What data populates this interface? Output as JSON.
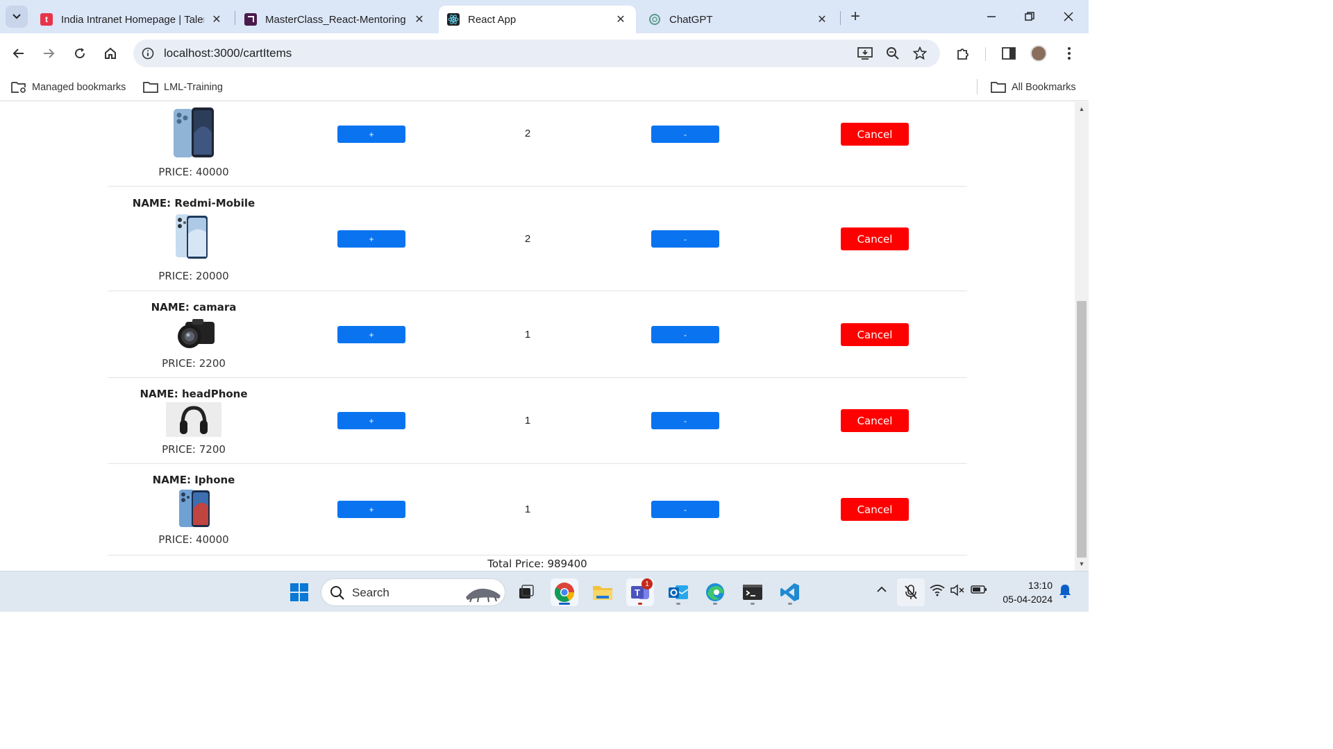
{
  "browser": {
    "tabs": [
      {
        "title": "India Intranet Homepage | Taler",
        "favicon_color": "#e8344a",
        "favicon_letter": "t",
        "active": false
      },
      {
        "title": "MasterClass_React-Mentoring s",
        "favicon_color": "#4a1a4a",
        "favicon_letter": "",
        "active": false
      },
      {
        "title": "React App",
        "favicon_color": "#222222",
        "favicon_letter": "",
        "active": true
      },
      {
        "title": "ChatGPT",
        "favicon_color": "#ffffff",
        "favicon_letter": "",
        "active": false
      }
    ],
    "url": "localhost:3000/cartItems",
    "bookmarks": {
      "managed": "Managed bookmarks",
      "folder": "LML-Training",
      "all": "All Bookmarks"
    }
  },
  "cart": {
    "name_prefix": "NAME: ",
    "price_prefix": "PRICE: ",
    "plus_label": "+",
    "minus_label": "-",
    "cancel_label": "Cancel",
    "items": [
      {
        "name": "",
        "price": "PRICE: 40000",
        "quantity": "2",
        "image": "blue-phone"
      },
      {
        "name": "NAME: Redmi-Mobile",
        "price": "PRICE: 20000",
        "quantity": "2",
        "image": "redmi-phone"
      },
      {
        "name": "NAME: camara",
        "price": "PRICE: 2200",
        "quantity": "1",
        "image": "camera"
      },
      {
        "name": "NAME: headPhone",
        "price": "PRICE: 7200",
        "quantity": "1",
        "image": "headphone"
      },
      {
        "name": "NAME: Iphone",
        "price": "PRICE: 40000",
        "quantity": "1",
        "image": "iphone"
      }
    ],
    "total": "Total Price: 989400"
  },
  "taskbar": {
    "search_placeholder": "Search",
    "teams_badge": "1",
    "time": "13:10",
    "date": "05-04-2024"
  },
  "colors": {
    "primary_button": "#0a74f0",
    "cancel_button": "#ff0000",
    "tabstrip": "#dbe6f7"
  }
}
